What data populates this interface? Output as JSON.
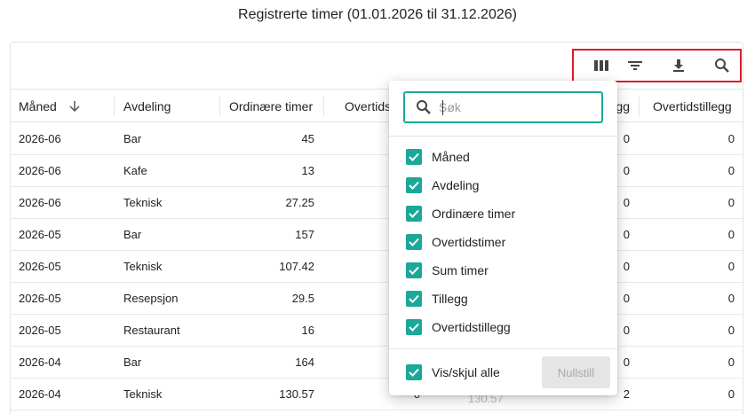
{
  "page": {
    "title": "Registrerte timer (01.01.2026 til 31.12.2026)"
  },
  "toolbar": {
    "icons": [
      "columns-icon",
      "filter-icon",
      "download-icon",
      "search-icon"
    ],
    "highlight_color": "#e0192b"
  },
  "table": {
    "columns": {
      "maned": "Måned",
      "avdeling": "Avdeling",
      "ordinaere": "Ordinære timer",
      "overtidstimer": "Overtidstimer",
      "tillegg": "Tillegg",
      "overtidstillegg": "Overtidstillegg"
    },
    "sort": {
      "column": "Måned",
      "direction": "descending"
    },
    "rows": [
      {
        "maned": "2026-06",
        "avdeling": "Bar",
        "ordinaere": "45",
        "tillegg": "0",
        "overtidstillegg": "0"
      },
      {
        "maned": "2026-06",
        "avdeling": "Kafe",
        "ordinaere": "13",
        "tillegg": "0",
        "overtidstillegg": "0"
      },
      {
        "maned": "2026-06",
        "avdeling": "Teknisk",
        "ordinaere": "27.25",
        "tillegg": "0",
        "overtidstillegg": "0"
      },
      {
        "maned": "2026-05",
        "avdeling": "Bar",
        "ordinaere": "157",
        "tillegg": "0",
        "overtidstillegg": "0"
      },
      {
        "maned": "2026-05",
        "avdeling": "Teknisk",
        "ordinaere": "107.42",
        "tillegg": "0",
        "overtidstillegg": "0"
      },
      {
        "maned": "2026-05",
        "avdeling": "Resepsjon",
        "ordinaere": "29.5",
        "tillegg": "0",
        "overtidstillegg": "0"
      },
      {
        "maned": "2026-05",
        "avdeling": "Restaurant",
        "ordinaere": "16",
        "tillegg": "0",
        "overtidstillegg": "0"
      },
      {
        "maned": "2026-04",
        "avdeling": "Bar",
        "ordinaere": "164",
        "tillegg": "0",
        "overtidstillegg": "0"
      },
      {
        "maned": "2026-04",
        "avdeling": "Teknisk",
        "ordinaere": "130.57",
        "tillegg": "2",
        "overtidstillegg": "0"
      }
    ],
    "partial_tail": {
      "overtidstimer": "0",
      "sum_timer": "130.57"
    }
  },
  "column_picker": {
    "search_placeholder": "Søk",
    "search_value": "",
    "options": [
      {
        "label": "Måned",
        "checked": true
      },
      {
        "label": "Avdeling",
        "checked": true
      },
      {
        "label": "Ordinære timer",
        "checked": true
      },
      {
        "label": "Overtidstimer",
        "checked": true
      },
      {
        "label": "Sum timer",
        "checked": true
      },
      {
        "label": "Tillegg",
        "checked": true
      },
      {
        "label": "Overtidstillegg",
        "checked": true
      }
    ],
    "toggle_all_label": "Vis/skjul alle",
    "toggle_all_checked": true,
    "reset_label": "Nullstill",
    "accent_color": "#1ba898"
  }
}
